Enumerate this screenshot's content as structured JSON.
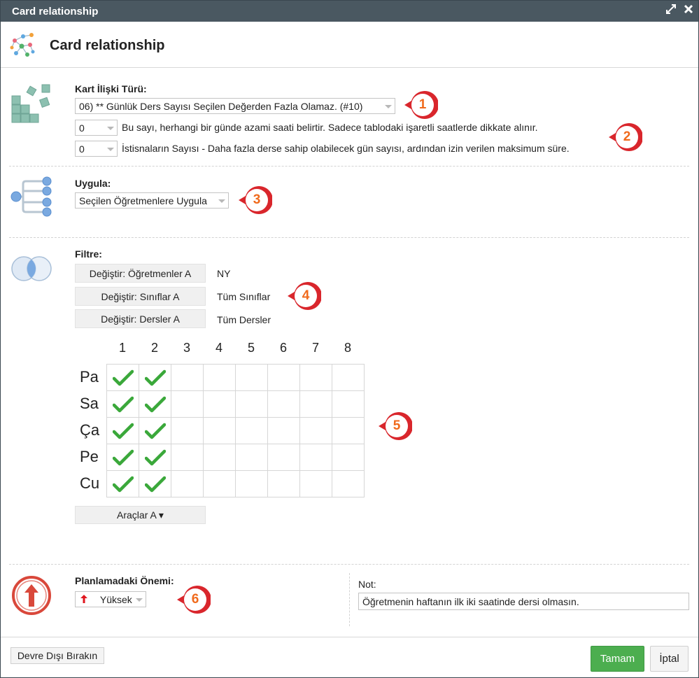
{
  "window": {
    "title": "Card relationship",
    "header_title": "Card relationship"
  },
  "relation": {
    "label": "Kart İlişki Türü:",
    "type_value": "06) ** Günlük Ders Sayısı Seçilen Değerden Fazla Olamaz. (#10)",
    "param1_value": "0",
    "param1_text": "Bu sayı, herhangi bir günde azami saati belirtir. Sadece tablodaki işaretli saatlerde dikkate alınır.",
    "param2_value": "0",
    "param2_text": "İstisnaların Sayısı - Daha fazla derse sahip olabilecek gün sayısı, ardından izin verilen maksimum süre."
  },
  "apply": {
    "label": "Uygula:",
    "value": "Seçilen Öğretmenlere Uygula"
  },
  "filter": {
    "label": "Filtre:",
    "rows": [
      {
        "button": "Değiştir: Öğretmenler A",
        "value": "NY"
      },
      {
        "button": "Değiştir: Sınıflar A",
        "value": "Tüm Sınıflar"
      },
      {
        "button": "Değiştir: Dersler A",
        "value": "Tüm Dersler"
      }
    ]
  },
  "grid": {
    "columns": [
      "1",
      "2",
      "3",
      "4",
      "5",
      "6",
      "7",
      "8"
    ],
    "rows": [
      "Pa",
      "Sa",
      "Ça",
      "Pe",
      "Cu"
    ],
    "checked": [
      [
        true,
        true,
        false,
        false,
        false,
        false,
        false,
        false
      ],
      [
        true,
        true,
        false,
        false,
        false,
        false,
        false,
        false
      ],
      [
        true,
        true,
        false,
        false,
        false,
        false,
        false,
        false
      ],
      [
        true,
        true,
        false,
        false,
        false,
        false,
        false,
        false
      ],
      [
        true,
        true,
        false,
        false,
        false,
        false,
        false,
        false
      ]
    ],
    "tools_button": "Araçlar A ▾"
  },
  "importance": {
    "label": "Planlamadaki Önemi:",
    "value": "Yüksek"
  },
  "note": {
    "label": "Not:",
    "value": "Öğretmenin haftanın ilk iki saatinde dersi olmasın."
  },
  "badges": [
    "1",
    "2",
    "3",
    "4",
    "5",
    "6"
  ],
  "footer": {
    "disable_button": "Devre Dışı Bırakın",
    "ok_button": "Tamam",
    "cancel_button": "İptal"
  },
  "colors": {
    "titlebar": "#4a5861",
    "ok_button": "#4cae4f",
    "badge_ring": "#d9262c",
    "badge_text": "#f06a1c",
    "check": "#3aa83a",
    "importance_icon": "#d9483b"
  }
}
